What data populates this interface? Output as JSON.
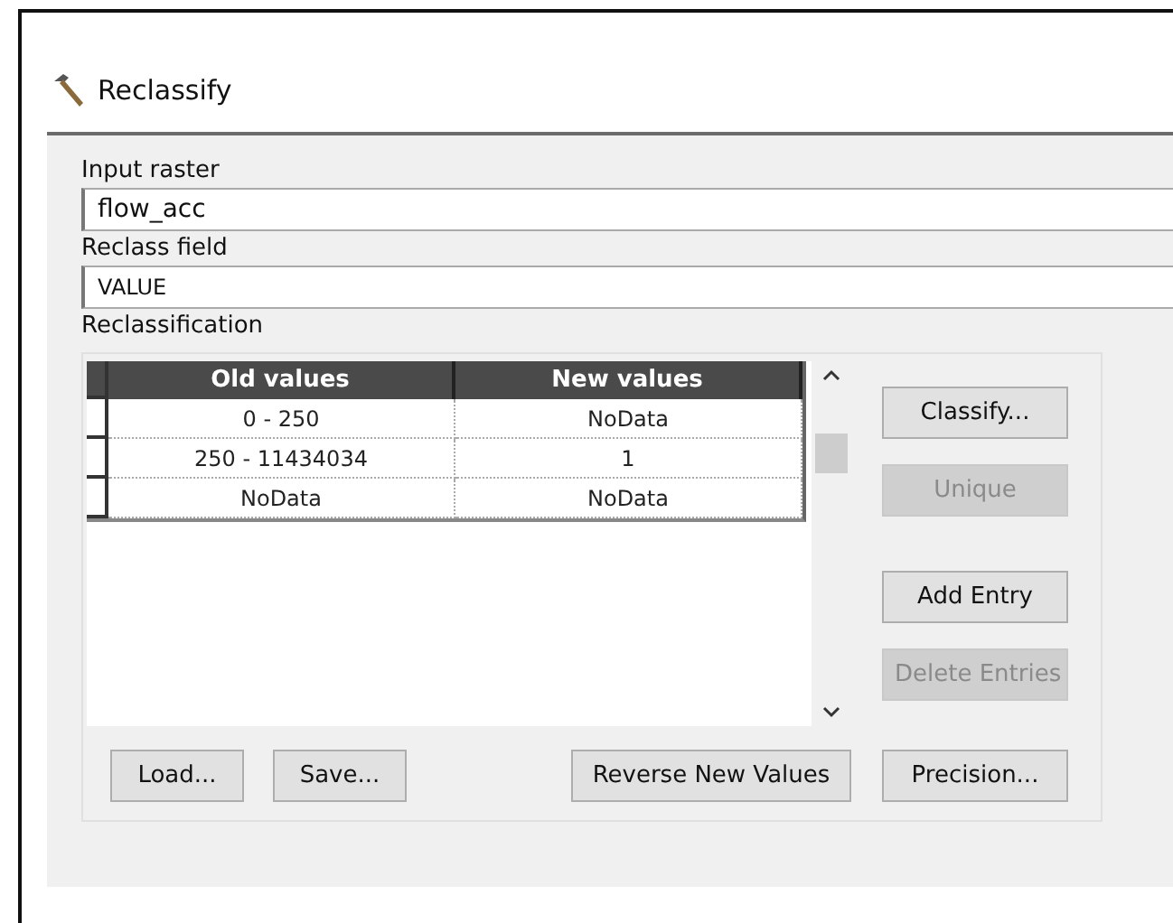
{
  "window": {
    "title": "Reclassify"
  },
  "input_raster": {
    "label": "Input raster",
    "value": "flow_acc"
  },
  "reclass_field": {
    "label": "Reclass field",
    "value": "VALUE"
  },
  "reclassification": {
    "label": "Reclassification",
    "table": {
      "columns": [
        "Old values",
        "New values"
      ],
      "rows": [
        [
          "0 - 250",
          "NoData"
        ],
        [
          "250 - 11434034",
          "1"
        ],
        [
          "NoData",
          "NoData"
        ]
      ]
    },
    "side_buttons": [
      {
        "label": "Classify...",
        "disabled": false
      },
      {
        "label": "Unique",
        "disabled": true
      },
      {
        "label": "Add Entry",
        "disabled": false
      },
      {
        "label": "Delete Entries",
        "disabled": true
      }
    ],
    "bottom_buttons": [
      {
        "label": "Load...",
        "disabled": false
      },
      {
        "label": "Save...",
        "disabled": false
      },
      {
        "label": "Reverse New Values",
        "disabled": false
      },
      {
        "label": "Precision...",
        "disabled": false
      }
    ]
  }
}
